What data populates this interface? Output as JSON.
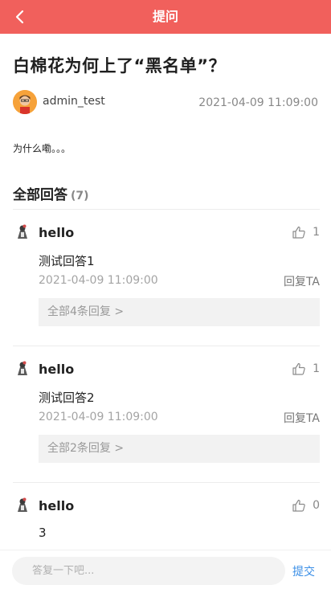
{
  "header": {
    "title": "提问",
    "back_icon": "chevron-left-icon"
  },
  "question": {
    "title": "白棉花为何上了“黑名单”？",
    "author": "admin_test",
    "date": "2021-04-09 11:09:00",
    "body": "为什么嘞。。。"
  },
  "answers_section": {
    "label": "全部回答",
    "count": "(7)"
  },
  "answers": [
    {
      "user": "hello",
      "likes": "1",
      "text": "测试回答1",
      "time": "2021-04-09 11:09:00",
      "reply_label": "回复TA",
      "more_replies": "全部4条回复 >"
    },
    {
      "user": "hello",
      "likes": "1",
      "text": "测试回答2",
      "time": "2021-04-09 11:09:00",
      "reply_label": "回复TA",
      "more_replies": "全部2条回复 >"
    },
    {
      "user": "hello",
      "likes": "0",
      "text": "3"
    }
  ],
  "bottom": {
    "placeholder": "答复一下吧...",
    "submit_label": "提交"
  },
  "colors": {
    "header_bg": "#f1605c",
    "link": "#3a8ee6"
  }
}
